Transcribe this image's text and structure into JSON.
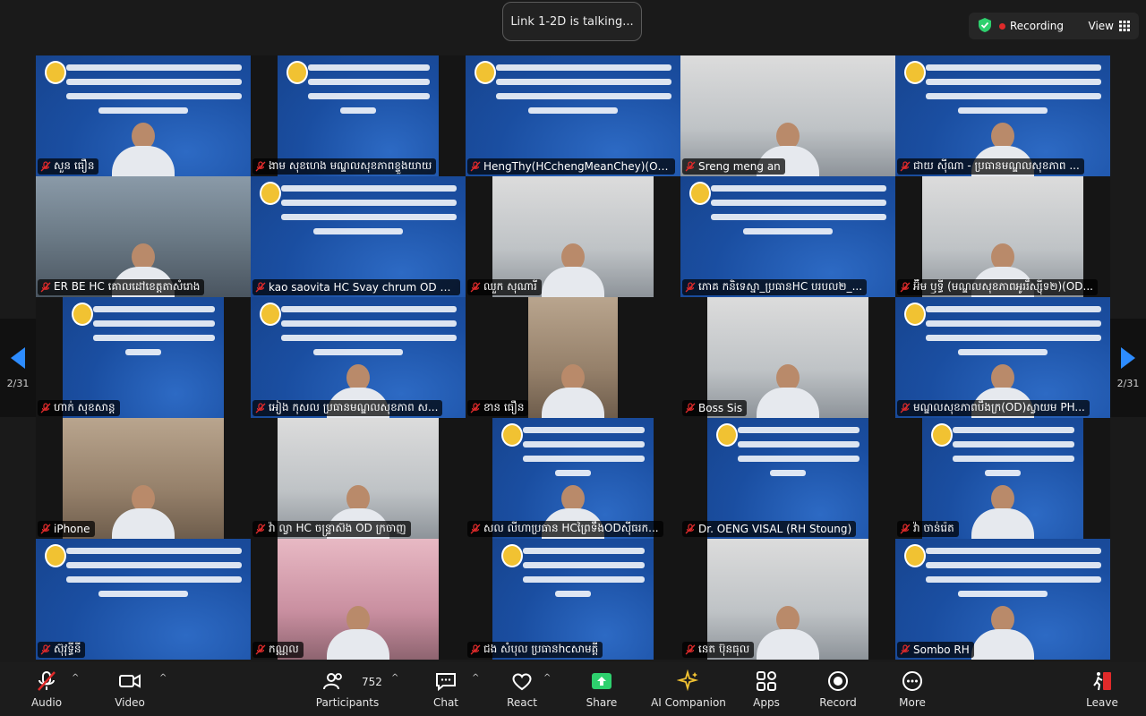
{
  "status": {
    "talking": "Link 1-2D is talking..."
  },
  "header": {
    "recording": "Recording",
    "view": "View"
  },
  "pagination": {
    "left": "2/31",
    "right": "2/31"
  },
  "tiles": [
    {
      "name": "សួន ធឿន",
      "kind": "slide-face"
    },
    {
      "name": "ងាម សុខហេង មណ្ឌលសុខភាពខ្ទួងយាយ",
      "kind": "slide"
    },
    {
      "name": "HengThy(HCchengMeanChey)(ODBT...",
      "kind": "slide"
    },
    {
      "name": "Sreng meng an",
      "kind": "cam-light"
    },
    {
      "name": "ជាយ ស៊ីណា - ប្រធានមណ្ឌលសុខភាព ...",
      "kind": "slide-face"
    },
    {
      "name": "ER BE HC គោលដៅខេត្តតាសំរោង",
      "kind": "cam"
    },
    {
      "name": "kao saovita HC Svay chrum OD ksach...",
      "kind": "slide"
    },
    {
      "name": "ឈួក សុណារី",
      "kind": "cam-light"
    },
    {
      "name": "ភោគ កនិទេស្នា_ប្រធានHC បរបល២_...",
      "kind": "slide"
    },
    {
      "name": "អ៊ឹម ឫទ្ធី (មណ្ឌលសុខភាពអូររឹស្ស៊ីទ២)(OD...",
      "kind": "cam-light"
    },
    {
      "name": "ហាក់ សុខសាន្ត",
      "kind": "slide"
    },
    {
      "name": "អៀង កុសល ប្រធានមណ្ឌលសុខភាព ស...",
      "kind": "slide-face"
    },
    {
      "name": "ខាន ធឿន",
      "kind": "cam-warm"
    },
    {
      "name": "Boss Sis",
      "kind": "cam-light"
    },
    {
      "name": "មណ្ឌលសុខភាពបឹងក្រ(OD)ស្វាយម PH...",
      "kind": "slide-face"
    },
    {
      "name": "iPhone",
      "kind": "cam-warm"
    },
    {
      "name": "វ៉ា ល្វា HC ចន្ទ្រាស៊ង OD ក្រចាញ",
      "kind": "cam-light"
    },
    {
      "name": "សល លីហាប្រធាន HCព្រៃទឹងODស៊ីធរក...",
      "kind": "slide-face"
    },
    {
      "name": "Dr. OENG VISAL (RH Stoung)",
      "kind": "slide"
    },
    {
      "name": "វ៉ា ចាន់រ៉េត",
      "kind": "slide-face"
    },
    {
      "name": "ស៊ុវុទ្ធីនី",
      "kind": "slide"
    },
    {
      "name": "កណ្ណល",
      "kind": "cam-pink"
    },
    {
      "name": "ជង សំបុល ប្រធានhcសាមគ្គី",
      "kind": "slide"
    },
    {
      "name": "នេត ប៊ុនធុល",
      "kind": "cam-light"
    },
    {
      "name": "Sombo RH",
      "kind": "slide-face"
    }
  ],
  "toolbar": {
    "audio": "Audio",
    "video": "Video",
    "participants": "Participants",
    "participants_count": "752",
    "chat": "Chat",
    "react": "React",
    "share": "Share",
    "ai_companion": "AI Companion",
    "apps": "Apps",
    "record": "Record",
    "more": "More",
    "leave": "Leave"
  },
  "colors": {
    "accent": "#2d8cff",
    "share": "#2ed06e",
    "recording": "#e02a2a",
    "slide": "#1a4ea1",
    "muted": "#e02a2a"
  }
}
